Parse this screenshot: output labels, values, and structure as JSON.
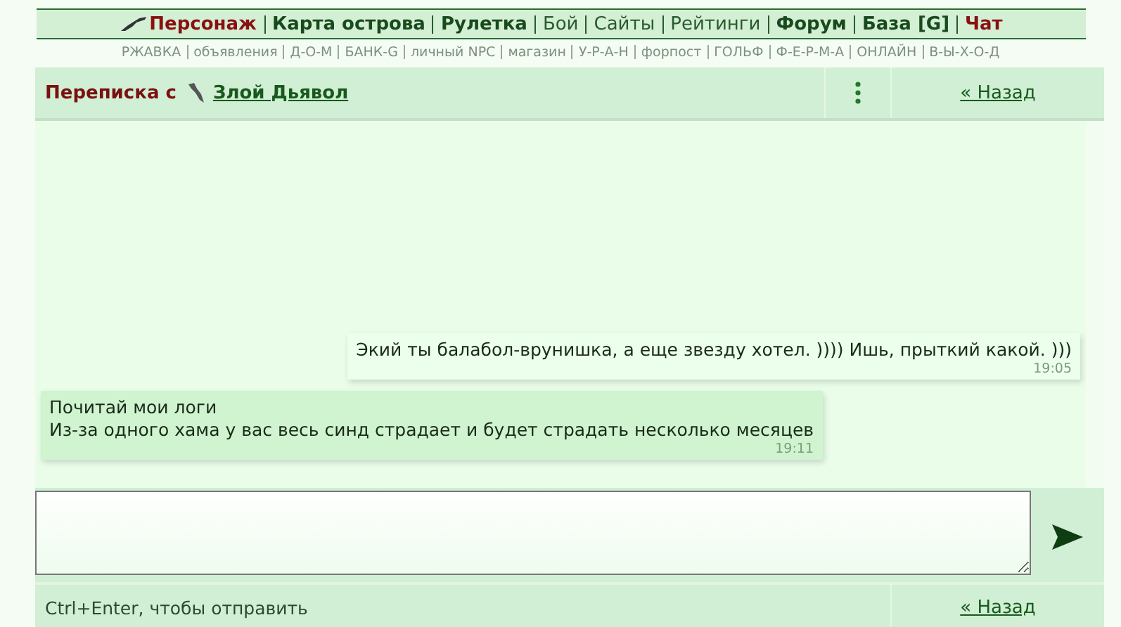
{
  "nav": [
    {
      "label": "Персонаж",
      "kind": "accent",
      "icon": true
    },
    {
      "label": "Карта острова",
      "kind": "bold"
    },
    {
      "label": "Рулетка",
      "kind": "bold"
    },
    {
      "label": "Бой",
      "kind": "plain"
    },
    {
      "label": "Сайты",
      "kind": "plain"
    },
    {
      "label": "Рейтинги",
      "kind": "plain"
    },
    {
      "label": "Форум",
      "kind": "bold"
    },
    {
      "label": "База [G]",
      "kind": "bold"
    },
    {
      "label": "Чат",
      "kind": "accent"
    }
  ],
  "subnav": [
    "РЖАВКА",
    "объявления",
    "Д-О-М",
    "БАНК-G",
    "личный NPC",
    "магазин",
    "У-Р-А-Н",
    "форпост",
    "ГОЛЬФ",
    "Ф-Е-Р-М-А",
    "ОНЛАЙН",
    "В-Ы-Х-О-Д"
  ],
  "header": {
    "title": "Переписка с",
    "user": "Злой Дьявол",
    "back": "« Назад"
  },
  "messages": [
    {
      "kind": "outgoing",
      "lines": [
        "Экий ты балабол-врунишка, а еще звезду хотел. )))) Ишь, прыткий какой. )))"
      ],
      "time": "19:05"
    },
    {
      "kind": "incoming",
      "lines": [
        "Почитай мои логи",
        "Из-за одного хама у вас весь синд страдает и будет страдать несколько месяцев"
      ],
      "time": "19:11"
    }
  ],
  "footer": {
    "hint": "Ctrl+Enter, чтобы отправить",
    "back": "« Назад"
  }
}
